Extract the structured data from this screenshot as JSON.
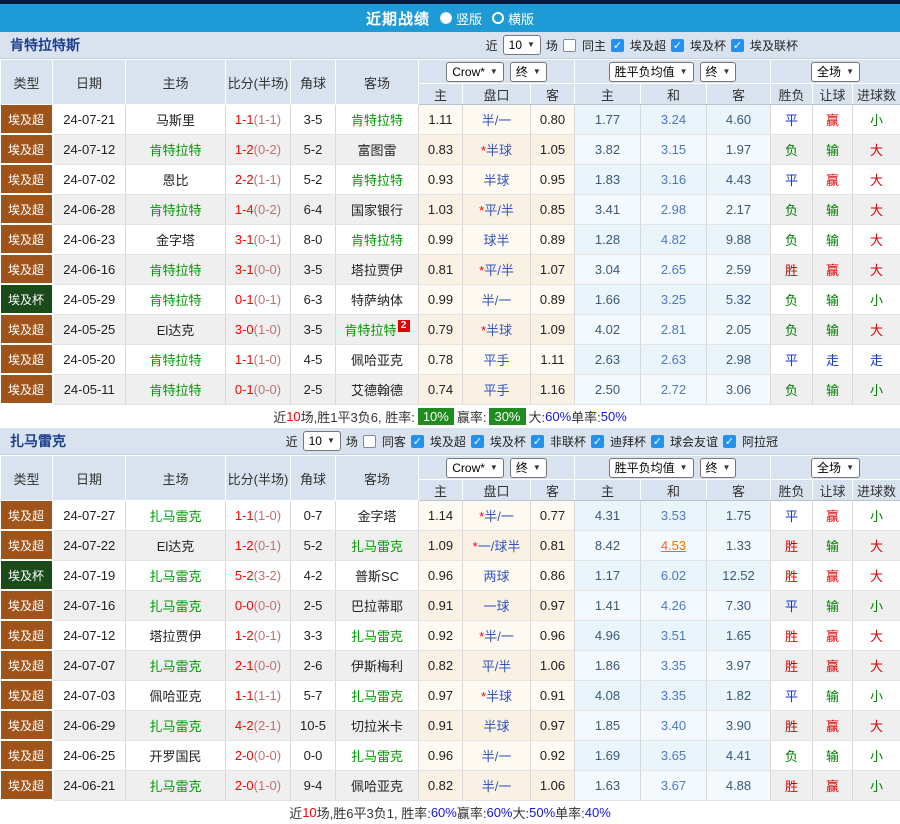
{
  "header": {
    "title": "近期战绩",
    "radios": [
      {
        "label": "竖版",
        "selected": true
      },
      {
        "label": "横版",
        "selected": false
      }
    ]
  },
  "colors": {
    "titlebar_blue": "#1E9BD7",
    "league_brown": "#A0541A",
    "cup_green": "#1B4A1B",
    "focal_team_green": "#009900",
    "score_red": "#FF0000",
    "result_red": "#E00000",
    "result_blue": "#1437CE",
    "result_green": "#008000",
    "summary_badge_green": "#1E8C1E",
    "highlight_orange": "#E87200"
  },
  "table_headers": {
    "left": [
      "类型",
      "日期",
      "主场",
      "比分(半场)",
      "角球",
      "客场"
    ],
    "sub": [
      "主",
      "盘口",
      "客",
      "主",
      "和",
      "客",
      "胜负",
      "让球",
      "进球数"
    ],
    "odds_source": "Crow*",
    "odds_stage": "终",
    "avg_source": "胜平负均值",
    "avg_stage": "终",
    "scope": "全场"
  },
  "sections": [
    {
      "team": "肯特拉特斯",
      "filter": {
        "near": "近",
        "games": "10",
        "games_suffix": "场",
        "same": {
          "label": "同主",
          "checked": false
        },
        "leagues": [
          {
            "label": "埃及超",
            "checked": true
          },
          {
            "label": "埃及杯",
            "checked": true
          },
          {
            "label": "埃及联杯",
            "checked": true
          }
        ]
      },
      "rows": [
        {
          "type": "埃及超",
          "date": "24-07-21",
          "home": {
            "name": "马斯里",
            "focal": false
          },
          "score_ft": "1-1",
          "score_ht": "(1-1)",
          "corners": "3-5",
          "away": {
            "name": "肯特拉特",
            "focal": true
          },
          "odds_home": "1.11",
          "pk_star": "",
          "pk": "半/一",
          "odds_away": "0.80",
          "avg": [
            "1.77",
            "3.24",
            "4.60"
          ],
          "avg_hl": -1,
          "result": [
            "平",
            "赢",
            "小"
          ]
        },
        {
          "type": "埃及超",
          "date": "24-07-12",
          "home": {
            "name": "肯特拉特",
            "focal": true
          },
          "score_ft": "1-2",
          "score_ht": "(0-2)",
          "corners": "5-2",
          "away": {
            "name": "富图雷",
            "focal": false
          },
          "odds_home": "0.83",
          "pk_star": "*",
          "pk": "半球",
          "odds_away": "1.05",
          "avg": [
            "3.82",
            "3.15",
            "1.97"
          ],
          "avg_hl": -1,
          "result": [
            "负",
            "输",
            "大"
          ]
        },
        {
          "type": "埃及超",
          "date": "24-07-02",
          "home": {
            "name": "恩比",
            "focal": false
          },
          "score_ft": "2-2",
          "score_ht": "(1-1)",
          "corners": "5-2",
          "away": {
            "name": "肯特拉特",
            "focal": true
          },
          "odds_home": "0.93",
          "pk_star": "",
          "pk": "半球",
          "odds_away": "0.95",
          "avg": [
            "1.83",
            "3.16",
            "4.43"
          ],
          "avg_hl": -1,
          "result": [
            "平",
            "赢",
            "大"
          ]
        },
        {
          "type": "埃及超",
          "date": "24-06-28",
          "home": {
            "name": "肯特拉特",
            "focal": true
          },
          "score_ft": "1-4",
          "score_ht": "(0-2)",
          "corners": "6-4",
          "away": {
            "name": "国家银行",
            "focal": false
          },
          "odds_home": "1.03",
          "pk_star": "*",
          "pk": "平/半",
          "odds_away": "0.85",
          "avg": [
            "3.41",
            "2.98",
            "2.17"
          ],
          "avg_hl": -1,
          "result": [
            "负",
            "输",
            "大"
          ]
        },
        {
          "type": "埃及超",
          "date": "24-06-23",
          "home": {
            "name": "金字塔",
            "focal": false
          },
          "score_ft": "3-1",
          "score_ht": "(0-1)",
          "corners": "8-0",
          "away": {
            "name": "肯特拉特",
            "focal": true
          },
          "odds_home": "0.99",
          "pk_star": "",
          "pk": "球半",
          "odds_away": "0.89",
          "avg": [
            "1.28",
            "4.82",
            "9.88"
          ],
          "avg_hl": -1,
          "result": [
            "负",
            "输",
            "大"
          ]
        },
        {
          "type": "埃及超",
          "date": "24-06-16",
          "home": {
            "name": "肯特拉特",
            "focal": true
          },
          "score_ft": "3-1",
          "score_ht": "(0-0)",
          "corners": "3-5",
          "away": {
            "name": "塔拉贾伊",
            "focal": false
          },
          "odds_home": "0.81",
          "pk_star": "*",
          "pk": "平/半",
          "odds_away": "1.07",
          "avg": [
            "3.04",
            "2.65",
            "2.59"
          ],
          "avg_hl": -1,
          "result": [
            "胜",
            "赢",
            "大"
          ]
        },
        {
          "type": "埃及杯",
          "date": "24-05-29",
          "home": {
            "name": "肯特拉特",
            "focal": true
          },
          "score_ft": "0-1",
          "score_ht": "(0-1)",
          "corners": "6-3",
          "away": {
            "name": "特萨纳体",
            "focal": false
          },
          "odds_home": "0.99",
          "pk_star": "",
          "pk": "半/一",
          "odds_away": "0.89",
          "avg": [
            "1.66",
            "3.25",
            "5.32"
          ],
          "avg_hl": -1,
          "result": [
            "负",
            "输",
            "小"
          ]
        },
        {
          "type": "埃及超",
          "date": "24-05-25",
          "home": {
            "name": "El达克",
            "focal": false
          },
          "score_ft": "3-0",
          "score_ht": "(1-0)",
          "corners": "3-5",
          "away": {
            "name": "肯特拉特",
            "focal": true,
            "badge": "2"
          },
          "odds_home": "0.79",
          "pk_star": "*",
          "pk": "半球",
          "odds_away": "1.09",
          "avg": [
            "4.02",
            "2.81",
            "2.05"
          ],
          "avg_hl": -1,
          "result": [
            "负",
            "输",
            "大"
          ]
        },
        {
          "type": "埃及超",
          "date": "24-05-20",
          "home": {
            "name": "肯特拉特",
            "focal": true
          },
          "score_ft": "1-1",
          "score_ht": "(1-0)",
          "corners": "4-5",
          "away": {
            "name": "佩哈亚克",
            "focal": false
          },
          "odds_home": "0.78",
          "pk_star": "",
          "pk": "平手",
          "odds_away": "1.11",
          "avg": [
            "2.63",
            "2.63",
            "2.98"
          ],
          "avg_hl": -1,
          "result": [
            "平",
            "走",
            "走"
          ]
        },
        {
          "type": "埃及超",
          "date": "24-05-11",
          "home": {
            "name": "肯特拉特",
            "focal": true
          },
          "score_ft": "0-1",
          "score_ht": "(0-0)",
          "corners": "2-5",
          "away": {
            "name": "艾德翰德",
            "focal": false
          },
          "odds_home": "0.74",
          "pk_star": "",
          "pk": "平手",
          "odds_away": "1.16",
          "avg": [
            "2.50",
            "2.72",
            "3.06"
          ],
          "avg_hl": -1,
          "result": [
            "负",
            "输",
            "小"
          ]
        }
      ],
      "summary": [
        {
          "t": "近",
          "c": "k"
        },
        {
          "t": "10",
          "c": "red"
        },
        {
          "t": "场,胜1平3负6, 胜率:",
          "c": "k"
        },
        {
          "t": "10%",
          "c": "badge"
        },
        {
          "t": " 赢率:",
          "c": "k"
        },
        {
          "t": "30%",
          "c": "badge"
        },
        {
          "t": " 大:",
          "c": "k"
        },
        {
          "t": "60%",
          "c": "blue"
        },
        {
          "t": " 单率:",
          "c": "k"
        },
        {
          "t": "50%",
          "c": "blue"
        }
      ]
    },
    {
      "team": "扎马雷克",
      "filter": {
        "near": "近",
        "games": "10",
        "games_suffix": "场",
        "same": {
          "label": "同客",
          "checked": false
        },
        "leagues": [
          {
            "label": "埃及超",
            "checked": true
          },
          {
            "label": "埃及杯",
            "checked": true
          },
          {
            "label": "非联杯",
            "checked": true
          },
          {
            "label": "迪拜杯",
            "checked": true
          },
          {
            "label": "球会友谊",
            "checked": true
          },
          {
            "label": "阿拉冠",
            "checked": true
          }
        ]
      },
      "rows": [
        {
          "type": "埃及超",
          "date": "24-07-27",
          "home": {
            "name": "扎马雷克",
            "focal": true
          },
          "score_ft": "1-1",
          "score_ht": "(1-0)",
          "corners": "0-7",
          "away": {
            "name": "金字塔",
            "focal": false
          },
          "odds_home": "1.14",
          "pk_star": "*",
          "pk": "半/一",
          "odds_away": "0.77",
          "avg": [
            "4.31",
            "3.53",
            "1.75"
          ],
          "avg_hl": -1,
          "result": [
            "平",
            "赢",
            "小"
          ]
        },
        {
          "type": "埃及超",
          "date": "24-07-22",
          "home": {
            "name": "El达克",
            "focal": false
          },
          "score_ft": "1-2",
          "score_ht": "(0-1)",
          "corners": "5-2",
          "away": {
            "name": "扎马雷克",
            "focal": true
          },
          "odds_home": "1.09",
          "pk_star": "*",
          "pk": "一/球半",
          "odds_away": "0.81",
          "avg": [
            "8.42",
            "4.53",
            "1.33"
          ],
          "avg_hl": 1,
          "result": [
            "胜",
            "输",
            "大"
          ]
        },
        {
          "type": "埃及杯",
          "date": "24-07-19",
          "home": {
            "name": "扎马雷克",
            "focal": true
          },
          "score_ft": "5-2",
          "score_ht": "(3-2)",
          "corners": "4-2",
          "away": {
            "name": "普斯SC",
            "focal": false
          },
          "odds_home": "0.96",
          "pk_star": "",
          "pk": "两球",
          "odds_away": "0.86",
          "avg": [
            "1.17",
            "6.02",
            "12.52"
          ],
          "avg_hl": -1,
          "result": [
            "胜",
            "赢",
            "大"
          ]
        },
        {
          "type": "埃及超",
          "date": "24-07-16",
          "home": {
            "name": "扎马雷克",
            "focal": true
          },
          "score_ft": "0-0",
          "score_ht": "(0-0)",
          "corners": "2-5",
          "away": {
            "name": "巴拉蒂耶",
            "focal": false
          },
          "odds_home": "0.91",
          "pk_star": "",
          "pk": "一球",
          "odds_away": "0.97",
          "avg": [
            "1.41",
            "4.26",
            "7.30"
          ],
          "avg_hl": -1,
          "result": [
            "平",
            "输",
            "小"
          ]
        },
        {
          "type": "埃及超",
          "date": "24-07-12",
          "home": {
            "name": "塔拉贾伊",
            "focal": false
          },
          "score_ft": "1-2",
          "score_ht": "(0-1)",
          "corners": "3-3",
          "away": {
            "name": "扎马雷克",
            "focal": true
          },
          "odds_home": "0.92",
          "pk_star": "*",
          "pk": "半/一",
          "odds_away": "0.96",
          "avg": [
            "4.96",
            "3.51",
            "1.65"
          ],
          "avg_hl": -1,
          "result": [
            "胜",
            "赢",
            "大"
          ]
        },
        {
          "type": "埃及超",
          "date": "24-07-07",
          "home": {
            "name": "扎马雷克",
            "focal": true
          },
          "score_ft": "2-1",
          "score_ht": "(0-0)",
          "corners": "2-6",
          "away": {
            "name": "伊斯梅利",
            "focal": false
          },
          "odds_home": "0.82",
          "pk_star": "",
          "pk": "平/半",
          "odds_away": "1.06",
          "avg": [
            "1.86",
            "3.35",
            "3.97"
          ],
          "avg_hl": -1,
          "result": [
            "胜",
            "赢",
            "大"
          ]
        },
        {
          "type": "埃及超",
          "date": "24-07-03",
          "home": {
            "name": "佩哈亚克",
            "focal": false
          },
          "score_ft": "1-1",
          "score_ht": "(1-1)",
          "corners": "5-7",
          "away": {
            "name": "扎马雷克",
            "focal": true
          },
          "odds_home": "0.97",
          "pk_star": "*",
          "pk": "半球",
          "odds_away": "0.91",
          "avg": [
            "4.08",
            "3.35",
            "1.82"
          ],
          "avg_hl": -1,
          "result": [
            "平",
            "输",
            "小"
          ]
        },
        {
          "type": "埃及超",
          "date": "24-06-29",
          "home": {
            "name": "扎马雷克",
            "focal": true
          },
          "score_ft": "4-2",
          "score_ht": "(2-1)",
          "corners": "10-5",
          "away": {
            "name": "切拉米卡",
            "focal": false
          },
          "odds_home": "0.91",
          "pk_star": "",
          "pk": "半球",
          "odds_away": "0.97",
          "avg": [
            "1.85",
            "3.40",
            "3.90"
          ],
          "avg_hl": -1,
          "result": [
            "胜",
            "赢",
            "大"
          ]
        },
        {
          "type": "埃及超",
          "date": "24-06-25",
          "home": {
            "name": "开罗国民",
            "focal": false
          },
          "score_ft": "2-0",
          "score_ht": "(0-0)",
          "corners": "0-0",
          "away": {
            "name": "扎马雷克",
            "focal": true
          },
          "odds_home": "0.96",
          "pk_star": "",
          "pk": "半/一",
          "odds_away": "0.92",
          "avg": [
            "1.69",
            "3.65",
            "4.41"
          ],
          "avg_hl": -1,
          "result": [
            "负",
            "输",
            "小"
          ]
        },
        {
          "type": "埃及超",
          "date": "24-06-21",
          "home": {
            "name": "扎马雷克",
            "focal": true
          },
          "score_ft": "2-0",
          "score_ht": "(1-0)",
          "corners": "9-4",
          "away": {
            "name": "佩哈亚克",
            "focal": false
          },
          "odds_home": "0.82",
          "pk_star": "",
          "pk": "半/一",
          "odds_away": "1.06",
          "avg": [
            "1.63",
            "3.67",
            "4.88"
          ],
          "avg_hl": -1,
          "result": [
            "胜",
            "赢",
            "小"
          ]
        }
      ],
      "summary": [
        {
          "t": "近",
          "c": "k"
        },
        {
          "t": "10",
          "c": "red"
        },
        {
          "t": "场,胜6平3负1, 胜率:",
          "c": "k"
        },
        {
          "t": "60%",
          "c": "blue"
        },
        {
          "t": " 赢率:",
          "c": "k"
        },
        {
          "t": "60%",
          "c": "blue"
        },
        {
          "t": " 大:",
          "c": "k"
        },
        {
          "t": "50%",
          "c": "blue"
        },
        {
          "t": " 单率:",
          "c": "k"
        },
        {
          "t": "40%",
          "c": "blue"
        }
      ]
    }
  ]
}
